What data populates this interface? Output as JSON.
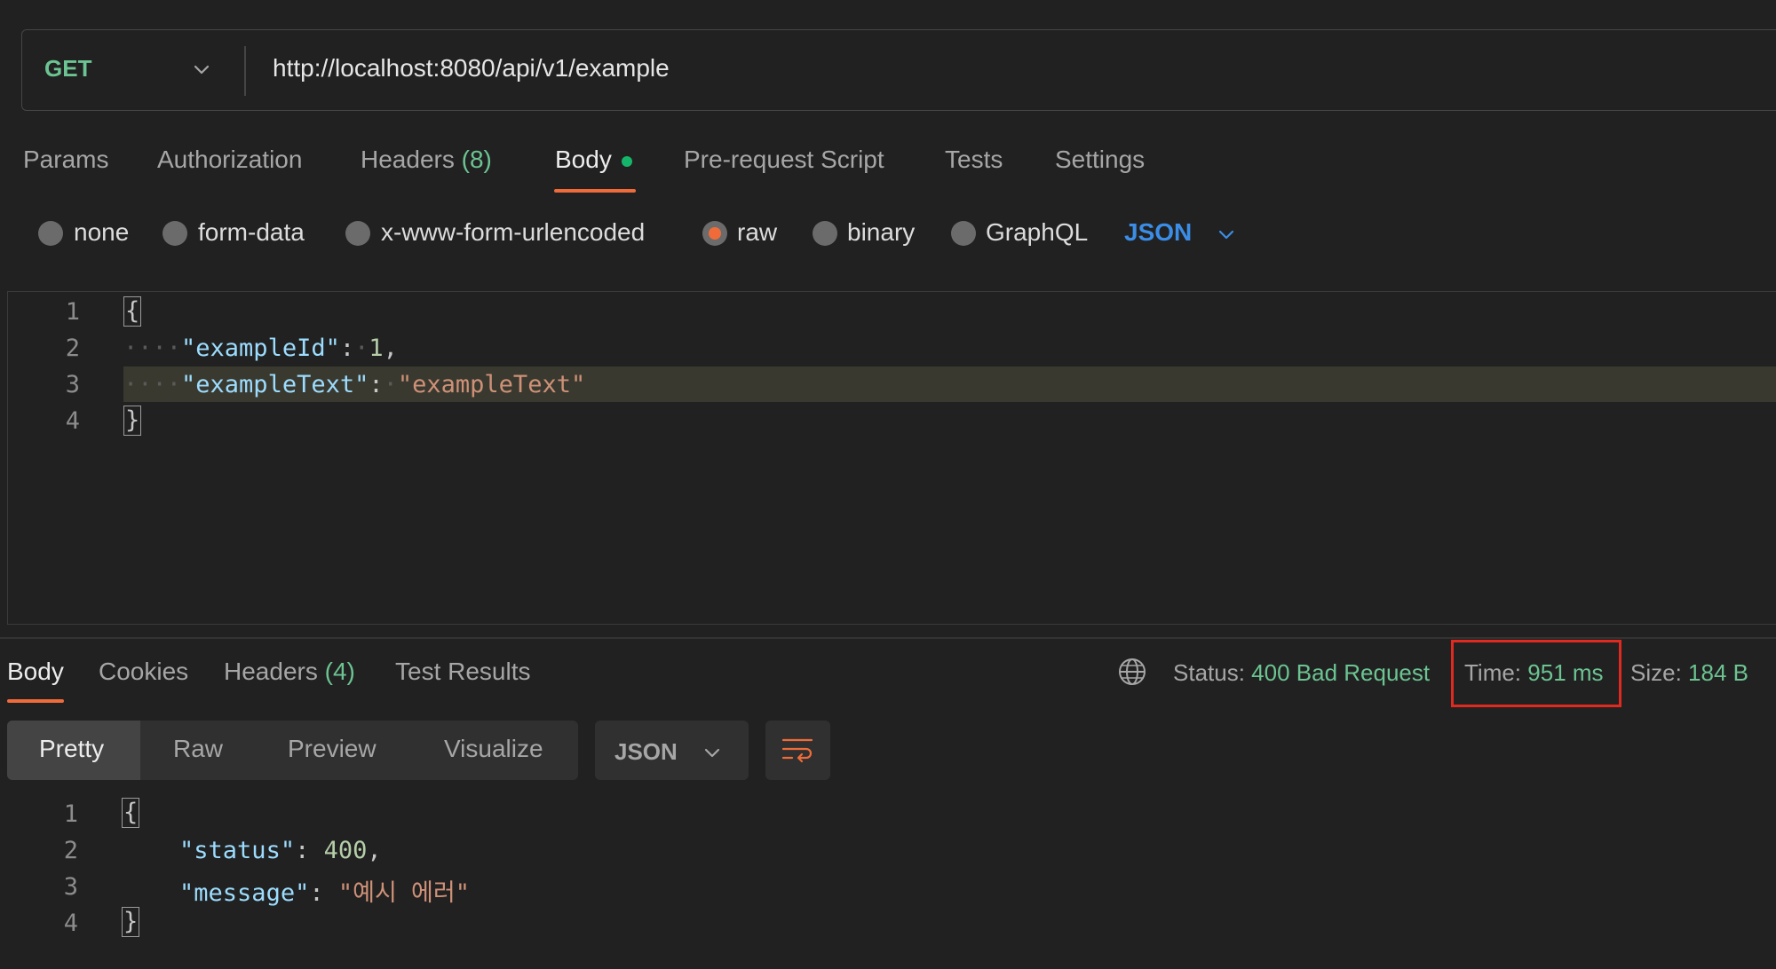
{
  "request": {
    "method": "GET",
    "url": "http://localhost:8080/api/v1/example"
  },
  "request_tabs": {
    "params": "Params",
    "authorization": "Authorization",
    "headers": "Headers",
    "headers_count": "(8)",
    "body": "Body",
    "prerequest": "Pre-request Script",
    "tests": "Tests",
    "settings": "Settings"
  },
  "body_types": {
    "none": "none",
    "form_data": "form-data",
    "urlencoded": "x-www-form-urlencoded",
    "raw": "raw",
    "binary": "binary",
    "graphql": "GraphQL",
    "selected": "raw",
    "format": "JSON"
  },
  "request_body": {
    "line_numbers": [
      "1",
      "2",
      "3",
      "4"
    ],
    "open_brace": "{",
    "close_brace": "}",
    "key1": "\"exampleId\"",
    "val1": "1",
    "key2": "\"exampleText\"",
    "val2": "\"exampleText\""
  },
  "response_tabs": {
    "body": "Body",
    "cookies": "Cookies",
    "headers": "Headers",
    "headers_count": "(4)",
    "test_results": "Test Results"
  },
  "response_status": {
    "status_label": "Status:",
    "status_value": "400 Bad Request",
    "time_label": "Time:",
    "time_value": "951 ms",
    "size_label": "Size:",
    "size_value": "184 B"
  },
  "view_modes": {
    "pretty": "Pretty",
    "raw": "Raw",
    "preview": "Preview",
    "visualize": "Visualize",
    "format": "JSON"
  },
  "response_body": {
    "line_numbers": [
      "1",
      "2",
      "3",
      "4"
    ],
    "open_brace": "{",
    "close_brace": "}",
    "key1": "\"status\"",
    "val1": "400",
    "key2": "\"message\"",
    "val2": "\"예시 에러\""
  },
  "colors": {
    "accent": "#ef6c3a",
    "method": "#6cc492",
    "highlight_box": "#e02a20",
    "link": "#3b8de6"
  }
}
